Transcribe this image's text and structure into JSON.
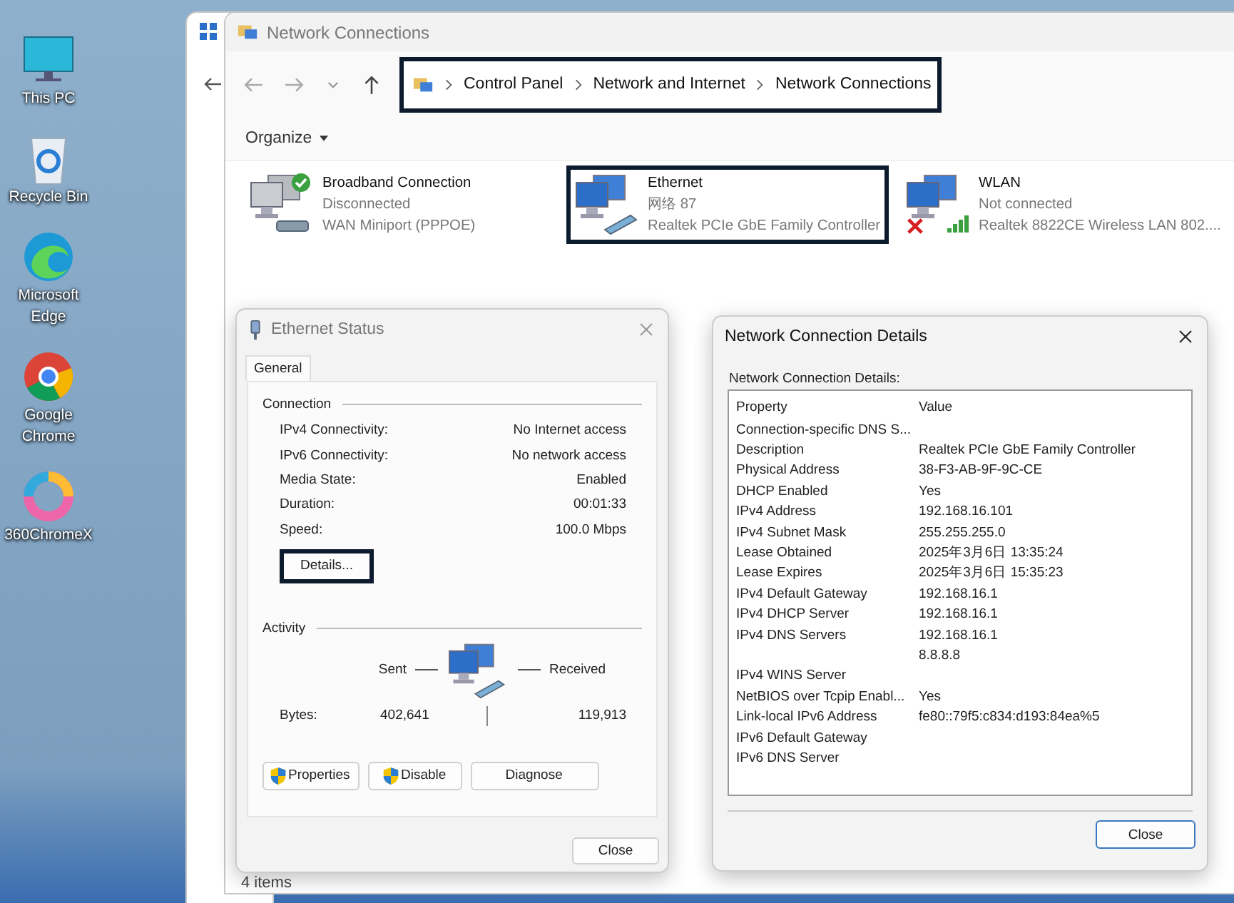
{
  "desktop_icons": [
    {
      "label": "This PC",
      "kind": "monitor"
    },
    {
      "label": "Recycle Bin",
      "kind": "recycle"
    },
    {
      "label": "Microsoft Edge",
      "kind": "edge"
    },
    {
      "label": "Google Chrome",
      "kind": "chrome"
    },
    {
      "label": "360ChromeX",
      "kind": "ring"
    }
  ],
  "window": {
    "title": "Network Connections",
    "breadcrumb": [
      "Control Panel",
      "Network and Internet",
      "Network Connections"
    ],
    "address_focused": true,
    "organize": "Organize",
    "status_bar": "4 items"
  },
  "connections": [
    {
      "name": "Broadband Connection",
      "status": "Disconnected",
      "device": "WAN Miniport (PPPOE)",
      "kind": "dialup",
      "ok_badge": true,
      "error_badge": false,
      "selected": false
    },
    {
      "name": "Ethernet",
      "status": "网络 87",
      "device": "Realtek PCIe GbE Family Controller",
      "kind": "wired",
      "ok_badge": false,
      "error_badge": false,
      "selected": true
    },
    {
      "name": "WLAN",
      "status": "Not connected",
      "device": "Realtek 8822CE Wireless LAN 802....",
      "kind": "wireless",
      "ok_badge": false,
      "error_badge": true,
      "selected": false
    }
  ],
  "status_dialog": {
    "title": "Ethernet Status",
    "tabs": [
      {
        "label": "General",
        "selected": true
      }
    ],
    "connection_heading": "Connection",
    "rows": [
      {
        "label": "IPv4 Connectivity:",
        "value": "No Internet access"
      },
      {
        "label": "IPv6 Connectivity:",
        "value": "No network access"
      },
      {
        "label": "Media State:",
        "value": "Enabled"
      },
      {
        "label": "Duration:",
        "value": "00:01:33"
      },
      {
        "label": "Speed:",
        "value": "100.0 Mbps"
      }
    ],
    "details_button": {
      "label": "Details...",
      "focused": true
    },
    "activity_heading": "Activity",
    "sent": "Sent",
    "received": "Received",
    "bytes_label": "Bytes:",
    "bytes_sent": "402,641",
    "bytes_received": "119,913",
    "buttons": [
      {
        "label": "Properties",
        "shield": true
      },
      {
        "label": "Disable",
        "shield": true
      },
      {
        "label": "Diagnose",
        "shield": false
      }
    ],
    "close": "Close"
  },
  "details_dialog": {
    "title": "Network Connection Details",
    "list_label": "Network Connection Details:",
    "columns": [
      "Property",
      "Value"
    ],
    "rows": [
      {
        "property": "Connection-specific DNS S...",
        "value": ""
      },
      {
        "property": "Description",
        "value": "Realtek PCIe GbE Family Controller"
      },
      {
        "property": "Physical Address",
        "value": "38-F3-AB-9F-9C-CE"
      },
      {
        "property": "DHCP Enabled",
        "value": "Yes"
      },
      {
        "property": "IPv4 Address",
        "value": "192.168.16.101"
      },
      {
        "property": "IPv4 Subnet Mask",
        "value": "255.255.255.0"
      },
      {
        "property": "Lease Obtained",
        "value": "2025年3月6日 13:35:24"
      },
      {
        "property": "Lease Expires",
        "value": "2025年3月6日 15:35:23"
      },
      {
        "property": "IPv4 Default Gateway",
        "value": "192.168.16.1"
      },
      {
        "property": "IPv4 DHCP Server",
        "value": "192.168.16.1"
      },
      {
        "property": "IPv4 DNS Servers",
        "value": "192.168.16.1"
      },
      {
        "property": "",
        "value": "8.8.8.8"
      },
      {
        "property": "IPv4 WINS Server",
        "value": ""
      },
      {
        "property": "NetBIOS over Tcpip Enabl...",
        "value": "Yes"
      },
      {
        "property": "Link-local IPv6 Address",
        "value": "fe80::79f5:c834:d193:84ea%5"
      },
      {
        "property": "IPv6 Default Gateway",
        "value": ""
      },
      {
        "property": "IPv6 DNS Server",
        "value": ""
      }
    ],
    "close": "Close"
  }
}
